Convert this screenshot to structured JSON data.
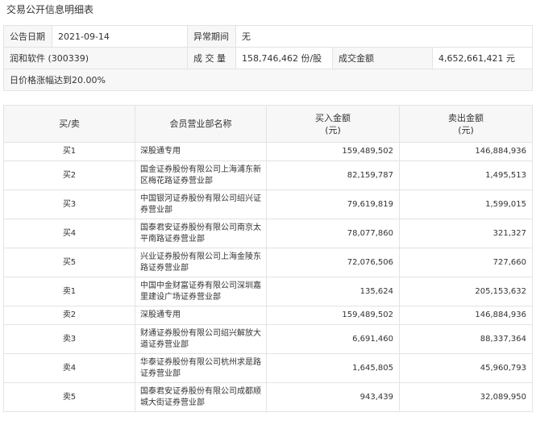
{
  "title": "交易公开信息明细表",
  "info": {
    "announce_date_label": "公告日期",
    "announce_date": "2021-09-14",
    "abnormal_period_label": "异常期间",
    "abnormal_period": "无",
    "stock_name": "润和软件 (300339)",
    "volume_label": "成 交 量",
    "volume": "158,746,462 份/股",
    "amount_label": "成交金额",
    "amount": "4,652,661,421 元",
    "reason": "日价格涨幅达到20.00%"
  },
  "table": {
    "headers": {
      "side": "买/卖",
      "dept": "会员营业部名称",
      "buy": "买入金额",
      "buy_unit": "(元)",
      "sell": "卖出金额",
      "sell_unit": "(元)"
    },
    "rows": [
      {
        "side": "买1",
        "dept": "深股通专用",
        "buy": "159,489,502",
        "sell": "146,884,936"
      },
      {
        "side": "买2",
        "dept": "国金证券股份有限公司上海浦东新区梅花路证券营业部",
        "buy": "82,159,787",
        "sell": "1,495,513"
      },
      {
        "side": "买3",
        "dept": "中国银河证券股份有限公司绍兴证券营业部",
        "buy": "79,619,819",
        "sell": "1,599,015"
      },
      {
        "side": "买4",
        "dept": "国泰君安证券股份有限公司南京太平南路证券营业部",
        "buy": "78,077,860",
        "sell": "321,327"
      },
      {
        "side": "买5",
        "dept": "兴业证券股份有限公司上海金陵东路证券营业部",
        "buy": "72,076,506",
        "sell": "727,660"
      },
      {
        "side": "卖1",
        "dept": "中国中金财富证券有限公司深圳嘉里建设广场证券营业部",
        "buy": "135,624",
        "sell": "205,153,632"
      },
      {
        "side": "卖2",
        "dept": "深股通专用",
        "buy": "159,489,502",
        "sell": "146,884,936"
      },
      {
        "side": "卖3",
        "dept": "财通证券股份有限公司绍兴解放大道证券营业部",
        "buy": "6,691,460",
        "sell": "88,337,364"
      },
      {
        "side": "卖4",
        "dept": "华泰证券股份有限公司杭州求是路证券营业部",
        "buy": "1,645,805",
        "sell": "45,960,793"
      },
      {
        "side": "卖5",
        "dept": "国泰君安证券股份有限公司成都顺城大街证券营业部",
        "buy": "943,439",
        "sell": "32,089,950"
      }
    ]
  }
}
